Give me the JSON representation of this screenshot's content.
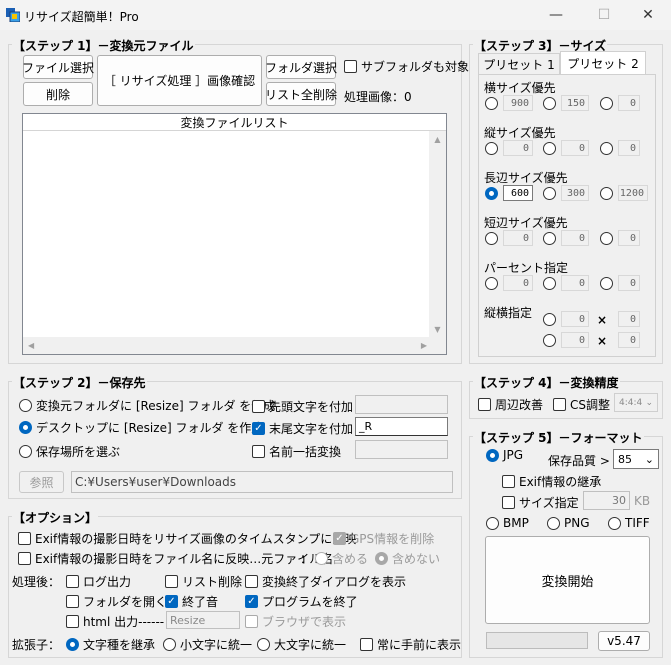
{
  "window": {
    "title": "リサイズ超簡単！Pro",
    "minimize": "—",
    "maximize": "☐",
    "close": "✕"
  },
  "step1": {
    "title": "【ステップ 1】－変換元ファイル",
    "file_select": "ファイル選択",
    "delete": "削除",
    "resize_check": "［ リサイズ処理 ］画像確認",
    "folder_select": "フォルダ選択",
    "clear_list": "リスト全削除",
    "subfolder": "サブフォルダも対象",
    "processed_label": "処理画像：",
    "processed_count": "0",
    "list_header": "変換ファイルリスト"
  },
  "step2": {
    "title": "【ステップ 2】－保存先",
    "opt_source": "変換元フォルダに [Resize] フォルダ を作成",
    "opt_desktop": "デスクトップに [Resize] フォルダ を作成",
    "opt_choose": "保存場所を選ぶ",
    "prefix": "先頭文字を付加",
    "suffix": "末尾文字を付加",
    "suffix_value": "_R",
    "rename": "名前一括変換",
    "browse": "参照",
    "path": "C:¥Users¥user¥Downloads"
  },
  "options": {
    "title": "【オプション】",
    "exif_timestamp": "Exif情報の撮影日時をリサイズ画像のタイムスタンプに反映",
    "gps_delete": "GPS情報を削除",
    "exif_filename": "Exif情報の撮影日時をファイル名に反映…元ファイル名",
    "contains_sep": "：",
    "include": "含める",
    "exclude": "含めない",
    "after_label": "処理後：",
    "log_output": "ログ出力",
    "list_delete": "リスト削除",
    "show_dialog": "変換終了ダイアログを表示",
    "open_folder": "フォルダを開く",
    "end_sound": "終了音",
    "exit_program": "プログラムを終了",
    "html_output": "html 出力------",
    "html_value": "Resize",
    "show_browser": "ブラウザで表示",
    "ext_label": "拡張子：",
    "ext_keep": "文字種を継承",
    "ext_lower": "小文字に統一",
    "ext_upper": "大文字に統一",
    "always_front": "常に手前に表示"
  },
  "step3": {
    "title": "【ステップ 3】－サイズ",
    "tab1": "プリセット 1",
    "tab2": "プリセット 2",
    "width_priority": "横サイズ優先",
    "width_vals": [
      "900",
      "150",
      "0"
    ],
    "height_priority": "縦サイズ優先",
    "height_vals": [
      "0",
      "0",
      "0"
    ],
    "long_priority": "長辺サイズ優先",
    "long_vals": [
      "600",
      "300",
      "1200"
    ],
    "short_priority": "短辺サイズ優先",
    "short_vals": [
      "0",
      "0",
      "0"
    ],
    "percent": "パーセント指定",
    "percent_vals": [
      "0",
      "0",
      "0"
    ],
    "wh": "縦横指定",
    "wh_vals": [
      "0",
      "0",
      "0",
      "0"
    ],
    "times": "×"
  },
  "step4": {
    "title": "【ステップ 4】－変換精度",
    "sharpen": "周辺改善",
    "cs_adjust": "CS調整",
    "sampling": "4:4:4"
  },
  "step5": {
    "title": "【ステップ 5】－フォーマット",
    "jpg": "JPG",
    "quality_label": "保存品質 >",
    "quality": "85",
    "exif_keep": "Exif情報の継承",
    "size_spec": "サイズ指定",
    "size_value": "30",
    "kb": "KB",
    "bmp": "BMP",
    "png": "PNG",
    "tiff": "TIFF",
    "start": "変換開始",
    "version": "v5.47"
  },
  "colors": {
    "accent": "#0067c0",
    "background": "#f0f0f0"
  }
}
